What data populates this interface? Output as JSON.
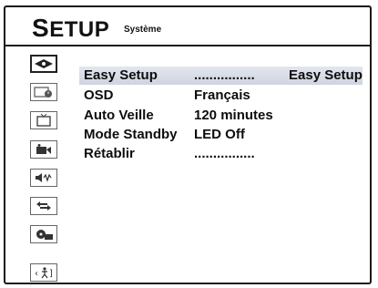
{
  "header": {
    "title_cap": "S",
    "title_rest": "ETUP",
    "subtitle": "Système"
  },
  "sidebar": {
    "items": [
      {
        "icon": "disc-settings-icon",
        "active": true
      },
      {
        "icon": "clock-icon",
        "active": false
      },
      {
        "icon": "tv-icon",
        "active": false
      },
      {
        "icon": "camera-icon",
        "active": false
      },
      {
        "icon": "speaker-audio-icon",
        "active": false
      },
      {
        "icon": "arrows-icon",
        "active": false
      },
      {
        "icon": "dvd-icon",
        "active": false
      },
      {
        "icon": "exit-icon",
        "active": false
      }
    ]
  },
  "menu": {
    "rows": [
      {
        "label": "Easy Setup",
        "value": "................",
        "option": "Easy Setup",
        "selected": true
      },
      {
        "label": "OSD",
        "value": "Français",
        "option": "",
        "selected": false
      },
      {
        "label": "Auto Veille",
        "value": "120 minutes",
        "option": "",
        "selected": false
      },
      {
        "label": "Mode Standby",
        "value": "LED Off",
        "option": "",
        "selected": false
      },
      {
        "label": "Rétablir",
        "value": "................",
        "option": "",
        "selected": false
      }
    ]
  }
}
